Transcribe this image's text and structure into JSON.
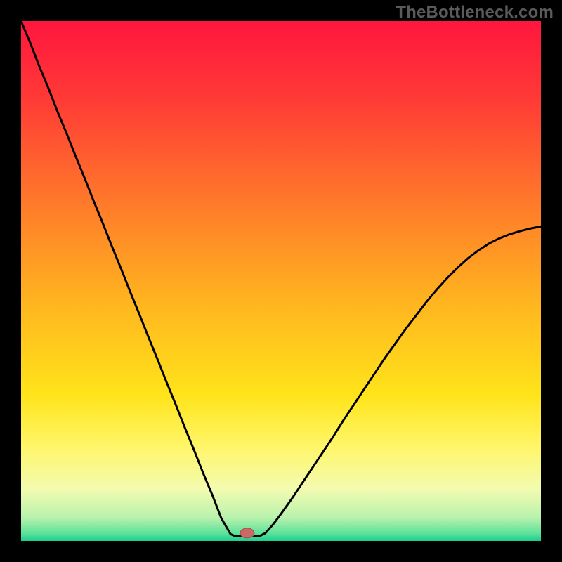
{
  "watermark": "TheBottleneck.com",
  "colors": {
    "frame": "#000000",
    "watermark_color": "#5a5a5a",
    "gradient_stops": [
      {
        "offset": 0.0,
        "color": "#ff163e"
      },
      {
        "offset": 0.15,
        "color": "#ff3a36"
      },
      {
        "offset": 0.35,
        "color": "#ff7a2a"
      },
      {
        "offset": 0.55,
        "color": "#ffb71f"
      },
      {
        "offset": 0.72,
        "color": "#ffe41a"
      },
      {
        "offset": 0.82,
        "color": "#fff66a"
      },
      {
        "offset": 0.9,
        "color": "#f3fbb0"
      },
      {
        "offset": 0.955,
        "color": "#b9f2ad"
      },
      {
        "offset": 0.985,
        "color": "#5fe29a"
      },
      {
        "offset": 1.0,
        "color": "#18cf8f"
      }
    ],
    "curve": "#000000",
    "marker_fill": "#c96a67",
    "marker_stroke": "#a74b48"
  },
  "chart_data": {
    "type": "line",
    "title": "",
    "xlabel": "",
    "ylabel": "",
    "x_range": [
      0,
      1
    ],
    "y_range": [
      0,
      1
    ],
    "marker": {
      "x": 0.435,
      "y": 0.015
    },
    "series": [
      {
        "name": "curve",
        "x": [
          0.0,
          0.018,
          0.035,
          0.053,
          0.07,
          0.088,
          0.105,
          0.123,
          0.14,
          0.158,
          0.175,
          0.193,
          0.21,
          0.228,
          0.245,
          0.263,
          0.28,
          0.298,
          0.315,
          0.333,
          0.35,
          0.368,
          0.385,
          0.403,
          0.41,
          0.42,
          0.43,
          0.44,
          0.45,
          0.46,
          0.47,
          0.485,
          0.5,
          0.52,
          0.54,
          0.56,
          0.58,
          0.6,
          0.62,
          0.64,
          0.66,
          0.68,
          0.7,
          0.72,
          0.74,
          0.76,
          0.78,
          0.8,
          0.82,
          0.84,
          0.86,
          0.88,
          0.9,
          0.92,
          0.94,
          0.96,
          0.98,
          1.0
        ],
        "y": [
          1.0,
          0.957,
          0.913,
          0.87,
          0.826,
          0.783,
          0.74,
          0.696,
          0.653,
          0.609,
          0.566,
          0.522,
          0.479,
          0.435,
          0.392,
          0.348,
          0.305,
          0.261,
          0.218,
          0.174,
          0.131,
          0.088,
          0.044,
          0.013,
          0.01,
          0.01,
          0.01,
          0.01,
          0.01,
          0.01,
          0.015,
          0.032,
          0.052,
          0.08,
          0.11,
          0.14,
          0.17,
          0.2,
          0.232,
          0.262,
          0.292,
          0.322,
          0.352,
          0.38,
          0.408,
          0.434,
          0.46,
          0.484,
          0.506,
          0.526,
          0.544,
          0.559,
          0.572,
          0.582,
          0.59,
          0.596,
          0.601,
          0.605
        ]
      }
    ]
  }
}
